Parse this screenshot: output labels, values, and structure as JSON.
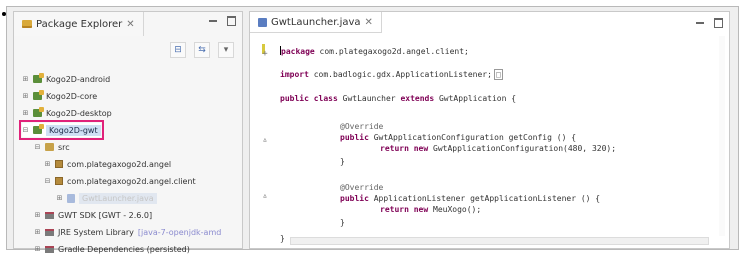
{
  "package_explorer": {
    "tab_label": "Package Explorer",
    "tab_close": "✕",
    "tree": [
      {
        "label": "Kogo2D-android",
        "twisty": "⊞",
        "icon": "project-icon"
      },
      {
        "label": "Kogo2D-core",
        "twisty": "⊞",
        "icon": "project-icon"
      },
      {
        "label": "Kogo2D-desktop",
        "twisty": "⊞",
        "icon": "project-icon"
      },
      {
        "label": "Kogo2D-gwt",
        "twisty": "⊟",
        "icon": "project-icon",
        "highlighted": true
      },
      {
        "label": "src",
        "twisty": "⊟",
        "icon": "source-folder-icon"
      },
      {
        "label": "com.plategaxogo2d.angel",
        "twisty": "⊞",
        "icon": "package-icon"
      },
      {
        "label": "com.plategaxogo2d.angel.client",
        "twisty": "⊟",
        "icon": "package-icon"
      },
      {
        "label": "GwtLauncher.java",
        "twisty": "⊞",
        "icon": "java-file-icon",
        "selected": true
      },
      {
        "label": "GWT SDK [GWT - 2.6.0]",
        "twisty": "⊞",
        "icon": "library-icon"
      },
      {
        "label": "JRE System Library",
        "decoration": "[java-7-openjdk-amd",
        "twisty": "⊞",
        "icon": "library-icon"
      },
      {
        "label": "Gradle Dependencies (persisted)",
        "twisty": "⊞",
        "icon": "library-icon"
      }
    ]
  },
  "editor": {
    "tab_label": "GwtLauncher.java",
    "tab_close": "✕",
    "code": {
      "package_kw": "package",
      "package_name": "com.plategaxogo2d.angel.client;",
      "import_kw": "import",
      "import_name": "com.badlogic.gdx.ApplicationListener;",
      "class_mods": "public class",
      "class_name": "GwtLauncher",
      "extends_kw": "extends",
      "class_super": "GwtApplication {",
      "override": "@Override",
      "public_kw": "public",
      "return_kw": "return new",
      "m1_sig": "GwtApplicationConfiguration getConfig () {",
      "m1_body": "GwtApplicationConfiguration(480, 320);",
      "m2_sig": "ApplicationListener getApplicationListener () {",
      "m2_body": "MeuXogo();",
      "brace": "}"
    }
  },
  "colors": {
    "keyword": "#7f0055",
    "highlight_outline": "#e0227a",
    "annotation": "#646464"
  }
}
